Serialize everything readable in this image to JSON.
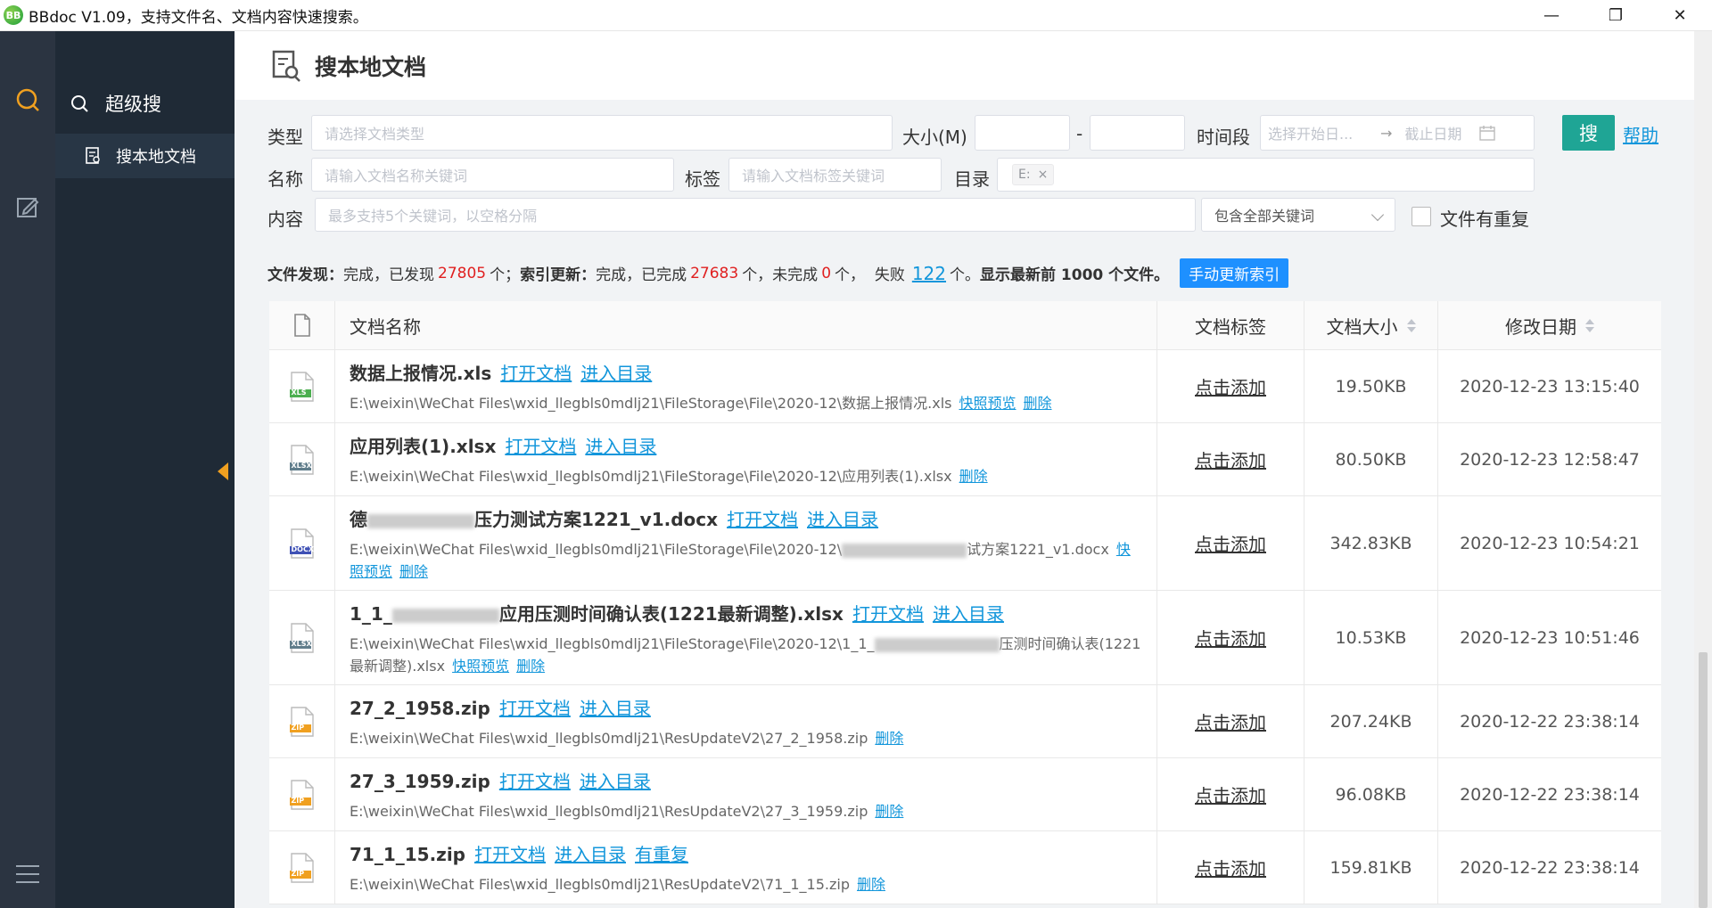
{
  "window": {
    "logo_text": "BB",
    "title": "BBdoc V1.09，支持文件名、文档内容快速搜索。",
    "minimize": "—",
    "restore": "❐",
    "close": "✕"
  },
  "sidebar": {
    "section_title": "超级搜",
    "sub_item": "搜本地文档"
  },
  "page": {
    "title": "搜本地文档"
  },
  "form": {
    "type_label": "类型",
    "type_placeholder": "请选择文档类型",
    "size_label": "大小(M)",
    "size_sep": "-",
    "time_label": "时间段",
    "time_start_placeholder": "选择开始日...",
    "time_arrow": "→",
    "time_end_placeholder": "截止日期",
    "search_button": "搜",
    "help_link": "帮助",
    "name_label": "名称",
    "name_placeholder": "请输入文档名称关键词",
    "tag_label": "标签",
    "tag_placeholder": "请输入文档标签关键词",
    "dir_label": "目录",
    "dir_chip": "E:",
    "dir_chip_close": "×",
    "content_label": "内容",
    "content_placeholder": "最多支持5个关键词，以空格分隔",
    "match_mode": "包含全部关键词",
    "dup_label": "文件有重复"
  },
  "status": {
    "discover_label": "文件发现：",
    "discover_text1": "完成，已发现",
    "discover_count": "27805",
    "discover_text2": "个；",
    "index_label": "索引更新：",
    "index_text1": "完成，已完成",
    "index_done": "27683",
    "index_text2": "个，未完成",
    "index_pending": "0",
    "index_text3": "个，  失败",
    "index_failed": "122",
    "index_text4": "个。",
    "limit_text": "显示最新前 1000 个文件。",
    "reindex_button": "手动更新索引"
  },
  "table": {
    "headers": {
      "name": "文档名称",
      "tag": "文档标签",
      "size": "文档大小",
      "date": "修改日期"
    },
    "rows": [
      {
        "icon": "xls-file-icon",
        "type": "XLS",
        "name": "数据上报情况.xls",
        "open": "打开文档",
        "dir": "进入目录",
        "path": "E:\\weixin\\WeChat Files\\wxid_llegbls0mdlj21\\FileStorage\\File\\2020-12\\数据上报情况.xls",
        "preview": "快照预览",
        "delete": "删除",
        "tag": "点击添加",
        "size": "19.50KB",
        "date": "2020-12-23 13:15:40"
      },
      {
        "icon": "xlsx-file-icon",
        "type": "XLSX",
        "name": "应用列表(1).xlsx",
        "open": "打开文档",
        "dir": "进入目录",
        "path": "E:\\weixin\\WeChat Files\\wxid_llegbls0mdlj21\\FileStorage\\File\\2020-12\\应用列表(1).xlsx",
        "delete": "删除",
        "tag": "点击添加",
        "size": "80.50KB",
        "date": "2020-12-23 12:58:47"
      },
      {
        "icon": "docx-file-icon",
        "type": "DOCX",
        "name_prefix": "德",
        "name": "压力测试方案1221_v1.docx",
        "open": "打开文档",
        "dir": "进入目录",
        "path": "E:\\weixin\\WeChat Files\\wxid_llegbls0mdlj21\\FileStorage\\File\\2020-12\\",
        "path_suffix": "试方案1221_v1.docx",
        "preview": "快照预览",
        "delete": "删除",
        "tag": "点击添加",
        "size": "342.83KB",
        "date": "2020-12-23 10:54:21"
      },
      {
        "icon": "xlsx-file-icon",
        "type": "XLSX",
        "name_prefix": "1_1_",
        "name": "应用压测时间确认表(1221最新调整).xlsx",
        "open": "打开文档",
        "dir": "进入目录",
        "path": "E:\\weixin\\WeChat Files\\wxid_llegbls0mdlj21\\FileStorage\\File\\2020-12\\1_1_",
        "path_suffix": "压测时间确认表(1221最新调整).xlsx",
        "preview": "快照预览",
        "delete": "删除",
        "tag": "点击添加",
        "size": "10.53KB",
        "date": "2020-12-23 10:51:46"
      },
      {
        "icon": "zip-file-icon",
        "type": "ZIP",
        "name": "27_2_1958.zip",
        "open": "打开文档",
        "dir": "进入目录",
        "path": "E:\\weixin\\WeChat Files\\wxid_llegbls0mdlj21\\ResUpdateV2\\27_2_1958.zip",
        "delete": "删除",
        "tag": "点击添加",
        "size": "207.24KB",
        "date": "2020-12-22 23:38:14"
      },
      {
        "icon": "zip-file-icon",
        "type": "ZIP",
        "name": "27_3_1959.zip",
        "open": "打开文档",
        "dir": "进入目录",
        "path": "E:\\weixin\\WeChat Files\\wxid_llegbls0mdlj21\\ResUpdateV2\\27_3_1959.zip",
        "delete": "删除",
        "tag": "点击添加",
        "size": "96.08KB",
        "date": "2020-12-22 23:38:14"
      },
      {
        "icon": "zip-file-icon",
        "type": "ZIP",
        "name": "71_1_15.zip",
        "open": "打开文档",
        "dir": "进入目录",
        "dup": "有重复",
        "path": "E:\\weixin\\WeChat Files\\wxid_llegbls0mdlj21\\ResUpdateV2\\71_1_15.zip",
        "delete": "删除",
        "tag": "点击添加",
        "size": "159.81KB",
        "date": "2020-12-22 23:38:14"
      }
    ]
  },
  "colors": {
    "accent": "#1fa595",
    "link": "#1296db",
    "sidebar_dark": "#1f2a36",
    "iconbar": "#2b3441",
    "highlight_orange": "#f0a020",
    "red_number": "#e02020",
    "reindex_blue": "#1e90ff"
  }
}
